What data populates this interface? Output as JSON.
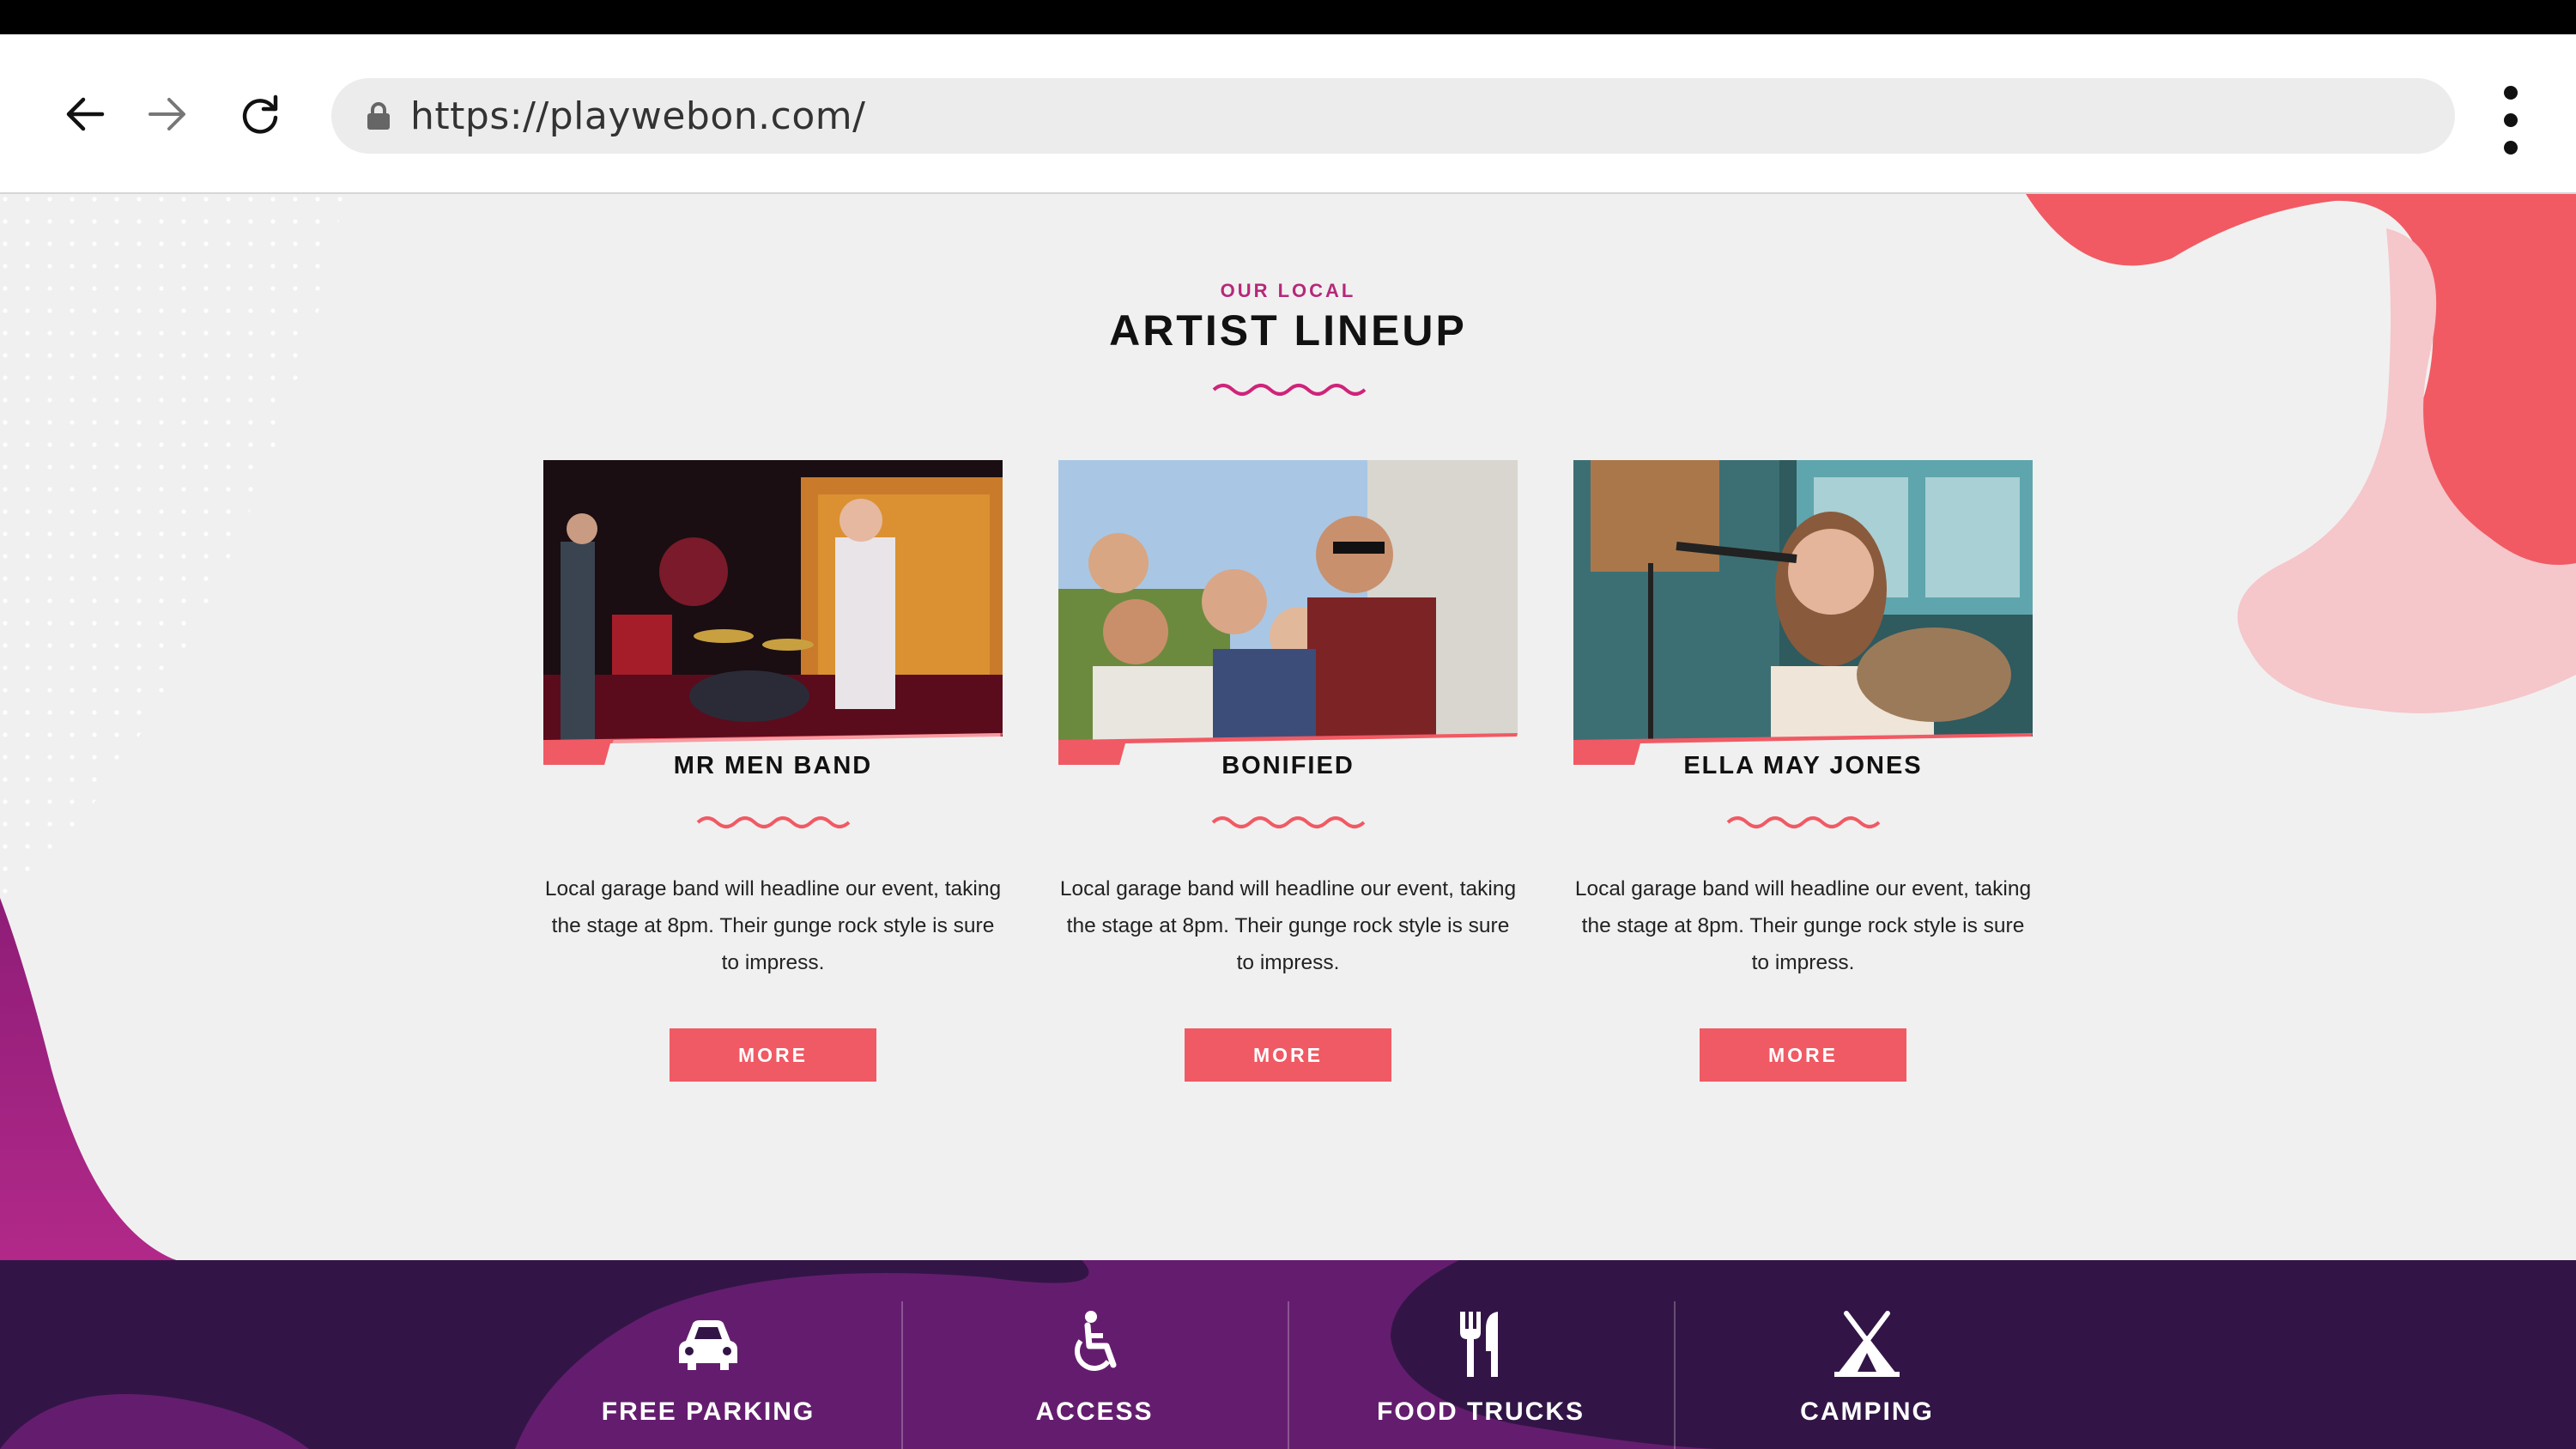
{
  "browser": {
    "url": "https://playwebon.com/",
    "back_icon": "arrow-left-icon",
    "forward_icon": "arrow-right-icon",
    "reload_icon": "reload-icon",
    "lock_icon": "lock-icon",
    "menu_icon": "vertical-dots-icon"
  },
  "section": {
    "eyebrow": "OUR LOCAL",
    "title": "ARTIST LINEUP"
  },
  "artists": [
    {
      "name": "MR MEN BAND",
      "description": "Local garage band will headline our event, taking the stage at 8pm.  Their gunge rock style is sure to impress.",
      "button": "MORE"
    },
    {
      "name": "BONIFIED",
      "description": "Local garage band will headline our event, taking the stage at 8pm.  Their gunge rock style is sure to impress.",
      "button": "MORE"
    },
    {
      "name": "ELLA MAY JONES",
      "description": "Local garage band will headline our event, taking the stage at 8pm.  Their gunge rock style is sure to impress.",
      "button": "MORE"
    }
  ],
  "amenities": [
    {
      "label": "FREE PARKING",
      "icon": "car-icon"
    },
    {
      "label": "ACCESS",
      "icon": "wheelchair-icon"
    },
    {
      "label": "FOOD TRUCKS",
      "icon": "fork-knife-icon"
    },
    {
      "label": "CAMPING",
      "icon": "tent-icon"
    }
  ],
  "colors": {
    "accent": "#f05a64",
    "eyebrow": "#b5287a",
    "footer": "#321546",
    "purple_blob": "#a0237f",
    "coral_blob": "#f15a63"
  }
}
